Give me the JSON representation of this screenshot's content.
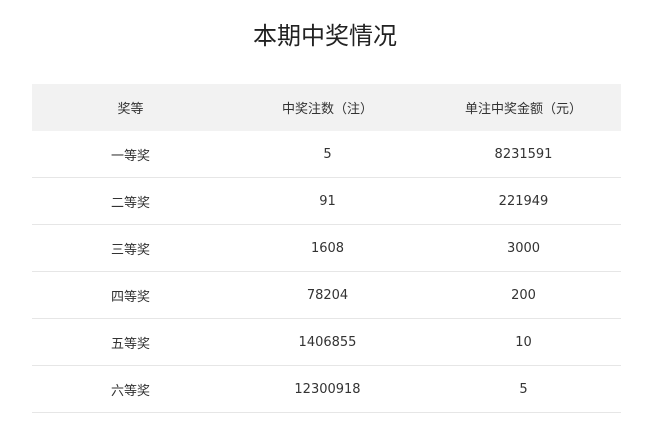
{
  "title": "本期中奖情况",
  "table": {
    "headers": [
      "奖等",
      "中奖注数（注）",
      "单注中奖金额（元）"
    ],
    "rows": [
      {
        "level": "一等奖",
        "count": "5",
        "amount": "8231591"
      },
      {
        "level": "二等奖",
        "count": "91",
        "amount": "221949"
      },
      {
        "level": "三等奖",
        "count": "1608",
        "amount": "3000"
      },
      {
        "level": "四等奖",
        "count": "78204",
        "amount": "200"
      },
      {
        "level": "五等奖",
        "count": "1406855",
        "amount": "10"
      },
      {
        "level": "六等奖",
        "count": "12300918",
        "amount": "5"
      }
    ]
  }
}
